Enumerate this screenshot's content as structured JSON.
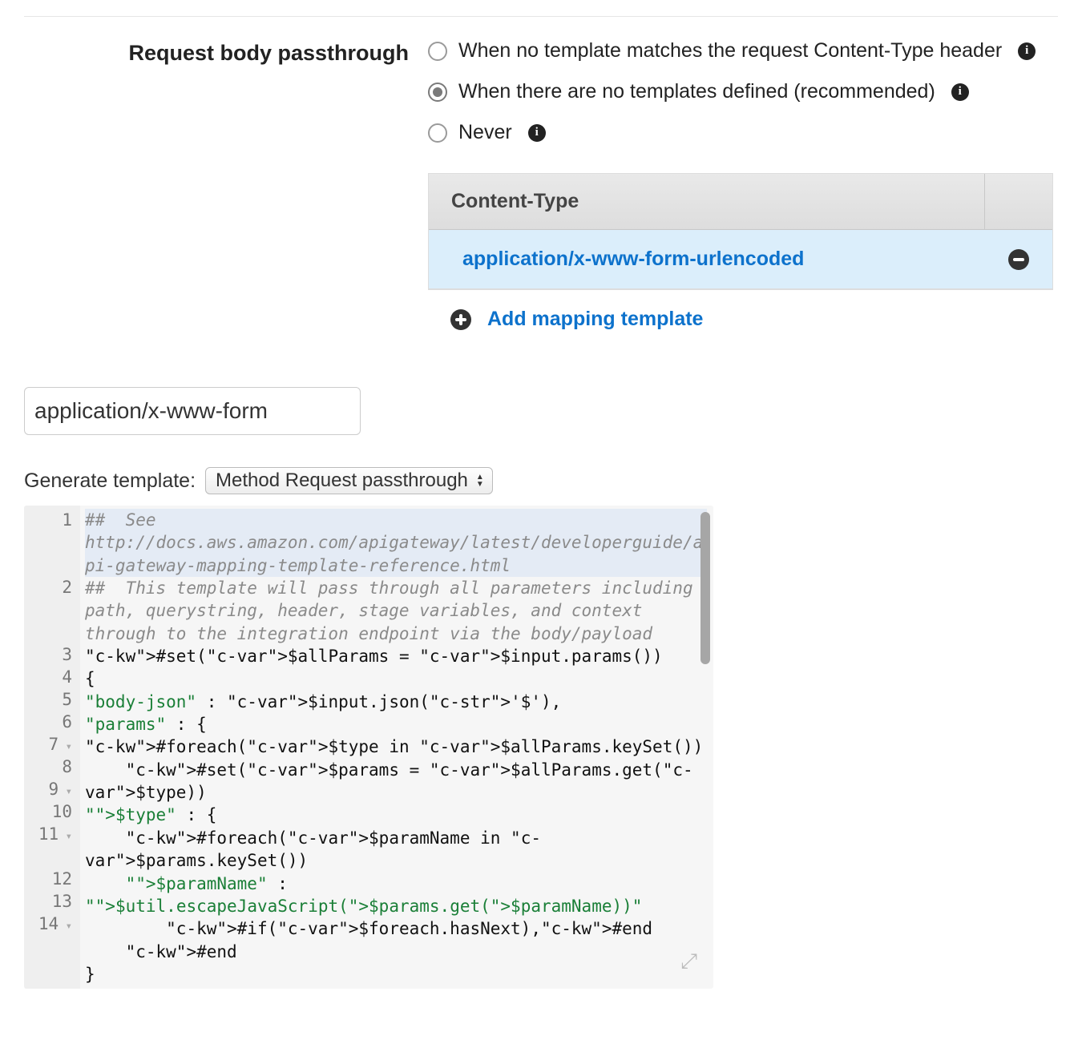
{
  "section_label": "Request body passthrough",
  "radios": {
    "opt1": {
      "label": "When no template matches the request Content-Type header",
      "checked": false
    },
    "opt2": {
      "label": "When there are no templates defined (recommended)",
      "checked": true
    },
    "opt3": {
      "label": "Never",
      "checked": false
    }
  },
  "templates": {
    "header": "Content-Type",
    "rows": [
      {
        "name": "application/x-www-form-urlencoded"
      }
    ],
    "add_label": "Add mapping template"
  },
  "content_type_input": "application/x-www-form",
  "generate": {
    "label": "Generate template:",
    "selected": "Method Request passthrough"
  },
  "editor_lines": [
    {
      "n": "1",
      "fold": false,
      "tall": "tall",
      "text": "##  See http://docs.aws.amazon.com/apigateway/latest/developerguide/api-gateway-mapping-template-reference.html"
    },
    {
      "n": "2",
      "fold": false,
      "tall": "tall",
      "text": "##  This template will pass through all parameters including path, querystring, header, stage variables, and context through to the integration endpoint via the body/payload"
    },
    {
      "n": "3",
      "fold": false,
      "text": "#set($allParams = $input.params())"
    },
    {
      "n": "4",
      "fold": false,
      "text": "{"
    },
    {
      "n": "5",
      "fold": false,
      "text": "\"body-json\" : $input.json('$'),"
    },
    {
      "n": "6",
      "fold": false,
      "text": "\"params\" : {"
    },
    {
      "n": "7",
      "fold": true,
      "text": "#foreach($type in $allParams.keySet())"
    },
    {
      "n": "8",
      "fold": false,
      "text": "    #set($params = $allParams.get($type))"
    },
    {
      "n": "9",
      "fold": true,
      "text": "\"$type\" : {"
    },
    {
      "n": "10",
      "fold": false,
      "text": "    #foreach($paramName in $params.keySet())"
    },
    {
      "n": "11",
      "fold": true,
      "tall": "tall2",
      "text": "    \"$paramName\" : \"$util.escapeJavaScript($params.get($paramName))\""
    },
    {
      "n": "12",
      "fold": false,
      "text": "        #if($foreach.hasNext),#end"
    },
    {
      "n": "13",
      "fold": false,
      "text": "    #end"
    },
    {
      "n": "14",
      "fold": true,
      "text": "}"
    }
  ]
}
